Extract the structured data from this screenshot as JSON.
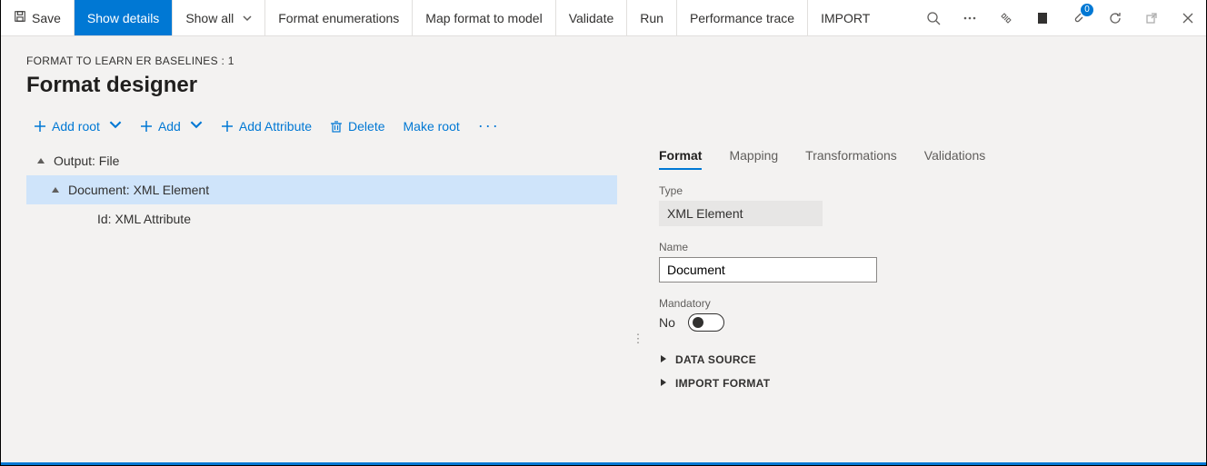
{
  "appbar": {
    "save": "Save",
    "show_details": "Show details",
    "show_all": "Show all",
    "format_enumerations": "Format enumerations",
    "map_format": "Map format to model",
    "validate": "Validate",
    "run": "Run",
    "perf_trace": "Performance trace",
    "import": "IMPORT",
    "notif_badge": "0"
  },
  "breadcrumb": "FORMAT TO LEARN ER BASELINES : 1",
  "page_title": "Format designer",
  "actions": {
    "add_root": "Add root",
    "add": "Add",
    "add_attribute": "Add Attribute",
    "delete": "Delete",
    "make_root": "Make root"
  },
  "tree": {
    "n0": "Output: File",
    "n1": "Document: XML Element",
    "n2": "Id: XML Attribute"
  },
  "tabs": {
    "format": "Format",
    "mapping": "Mapping",
    "transformations": "Transformations",
    "validations": "Validations"
  },
  "fields": {
    "type_label": "Type",
    "type_value": "XML Element",
    "name_label": "Name",
    "name_value": "Document",
    "mandatory_label": "Mandatory",
    "mandatory_value": "No"
  },
  "sections": {
    "data_source": "DATA SOURCE",
    "import_format": "IMPORT FORMAT"
  }
}
